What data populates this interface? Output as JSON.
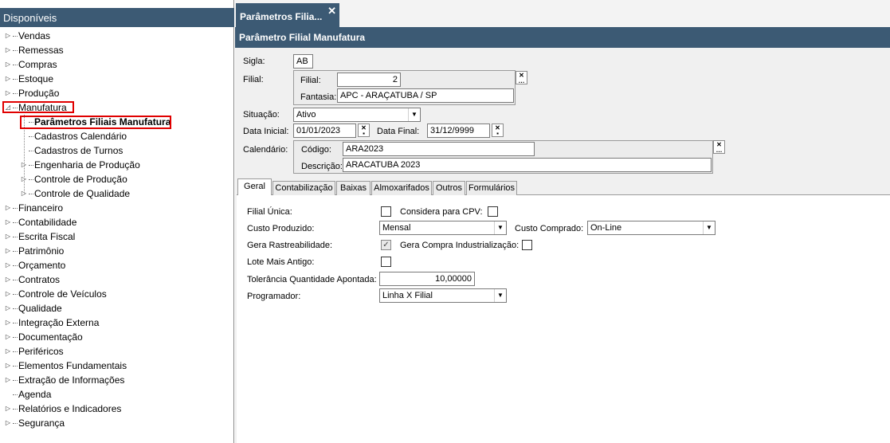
{
  "left": {
    "header": "Disponíveis",
    "tree": [
      {
        "label": "Vendas"
      },
      {
        "label": "Remessas"
      },
      {
        "label": "Compras"
      },
      {
        "label": "Estoque"
      },
      {
        "label": "Produção"
      },
      {
        "label": "Manufatura"
      },
      {
        "label": "Parâmetros Filiais Manufatura"
      },
      {
        "label": "Cadastros Calendário"
      },
      {
        "label": "Cadastros de Turnos"
      },
      {
        "label": "Engenharia de Produção"
      },
      {
        "label": "Controle de Produção"
      },
      {
        "label": "Controle de Qualidade"
      },
      {
        "label": "Financeiro"
      },
      {
        "label": "Contabilidade"
      },
      {
        "label": "Escrita Fiscal"
      },
      {
        "label": "Patrimônio"
      },
      {
        "label": "Orçamento"
      },
      {
        "label": "Contratos"
      },
      {
        "label": "Controle de Veículos"
      },
      {
        "label": "Qualidade"
      },
      {
        "label": "Integração Externa"
      },
      {
        "label": "Documentação"
      },
      {
        "label": "Periféricos"
      },
      {
        "label": "Elementos Fundamentais"
      },
      {
        "label": "Extração de Informações"
      },
      {
        "label": "Agenda"
      },
      {
        "label": "Relatórios e Indicadores"
      },
      {
        "label": "Segurança"
      }
    ]
  },
  "doc_tab": {
    "label": "Parâmetros Filia...",
    "close": "✕"
  },
  "form": {
    "title": "Parâmetro Filial Manufatura",
    "sigla_label": "Sigla:",
    "sigla_value": "AB",
    "filial_label": "Filial:",
    "filial_inner_label": "Filial:",
    "filial_value": "2",
    "fantasia_label": "Fantasia:",
    "fantasia_value": "APC - ARAÇATUBA / SP",
    "situacao_label": "Situação:",
    "situacao_value": "Ativo",
    "data_inicial_label": "Data Inicial:",
    "data_inicial_value": "01/01/2023",
    "data_final_label": "Data Final:",
    "data_final_value": "31/12/9999",
    "calendario_label": "Calendário:",
    "codigo_label": "Código:",
    "codigo_value": "ARA2023",
    "descricao_label": "Descrição:",
    "descricao_value": "ARACATUBA 2023"
  },
  "tabs": [
    {
      "label": "Geral"
    },
    {
      "label": "Contabilização"
    },
    {
      "label": "Baixas"
    },
    {
      "label": "Almoxarifados"
    },
    {
      "label": "Outros"
    },
    {
      "label": "Formulários"
    }
  ],
  "geral": {
    "filial_unica_label": "Filial Única:",
    "filial_unica_checked": false,
    "considera_cpv_label": "Considera para CPV:",
    "considera_cpv_checked": false,
    "custo_produzido_label": "Custo Produzido:",
    "custo_produzido_value": "Mensal",
    "custo_comprado_label": "Custo Comprado:",
    "custo_comprado_value": "On-Line",
    "gera_rastreabilidade_label": "Gera Rastreabilidade:",
    "gera_rastreabilidade_checked": true,
    "gera_compra_label": "Gera Compra Industrialização:",
    "gera_compra_checked": false,
    "lote_mais_antigo_label": "Lote Mais Antigo:",
    "lote_mais_antigo_checked": false,
    "tolerancia_label": "Tolerância Quantidade Apontada:",
    "tolerancia_value": "10,00000",
    "programador_label": "Programador:",
    "programador_value": "Linha X Filial"
  },
  "icons": {
    "expand": "▷",
    "expanded": "◿",
    "dropdown": "▼",
    "check": "✓",
    "search": "✕",
    "dots": "…"
  }
}
